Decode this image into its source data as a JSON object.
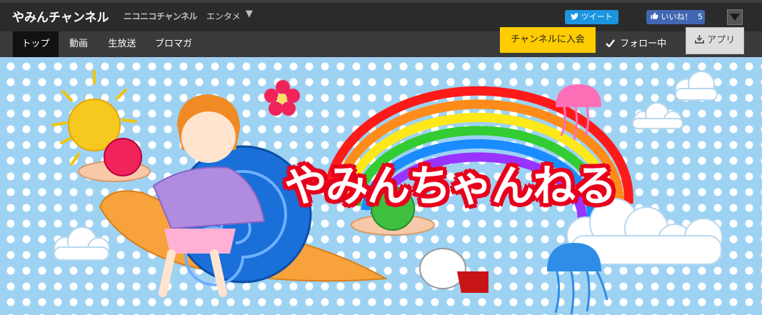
{
  "header": {
    "channel_title": "やみんチャンネル",
    "brand": "ニコニコチャンネル",
    "category": "エンタメ",
    "category_caret": "▼",
    "tweet_label": "ツイート",
    "like_label": "いいね！",
    "like_count": "5"
  },
  "nav": {
    "tabs": [
      {
        "label": "トップ",
        "active": true
      },
      {
        "label": "動画"
      },
      {
        "label": "生放送"
      },
      {
        "label": "ブロマガ"
      }
    ],
    "join_label": "チャンネルに入会",
    "follow_label": "フォロー中",
    "app_label": "アプリ"
  },
  "banner": {
    "title": "やみんちゃんねる"
  },
  "icons": [
    "twitter-bird-icon",
    "thumbs-up-icon",
    "menu-toggle-icon",
    "check-icon",
    "download-icon"
  ],
  "colors": {
    "join_button": "#ffcc00",
    "tweet_button": "#1b95e0",
    "like_button": "#4267b2",
    "banner_sky": "#9dd2f3",
    "title_outline": "#e8001c"
  }
}
